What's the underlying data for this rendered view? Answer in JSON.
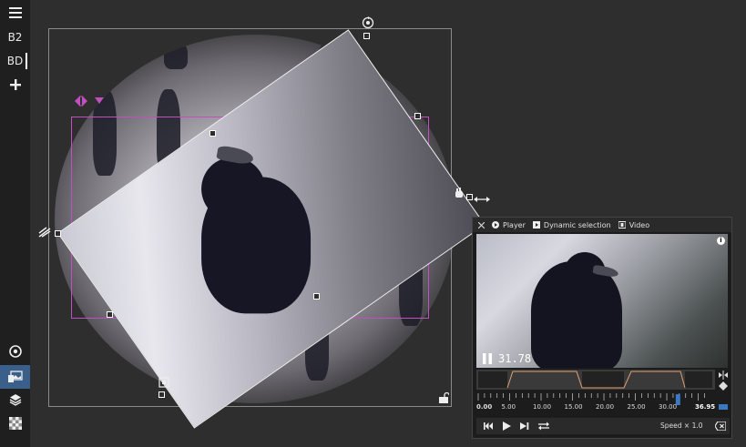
{
  "sidebar": {
    "items": [
      {
        "name": "menu-icon"
      },
      {
        "label": "B2"
      },
      {
        "label": "BD"
      },
      {
        "name": "add-icon"
      }
    ],
    "bottom_items": [
      {
        "name": "target-icon"
      },
      {
        "name": "image-select-icon"
      },
      {
        "name": "layers-icon"
      },
      {
        "name": "checkerboard-icon"
      }
    ]
  },
  "player": {
    "tabs": [
      {
        "label": "Player",
        "icon": "play-circle-icon"
      },
      {
        "label": "Dynamic selection",
        "icon": "play-square-icon"
      },
      {
        "label": "Video",
        "icon": "film-icon"
      }
    ],
    "timecode": "31.78",
    "ruler": {
      "ticks": [
        "0.00",
        "5.00",
        "10.00",
        "15.00",
        "20.00",
        "25.00",
        "30.00"
      ],
      "end_label": "36.95",
      "duration": 36.95,
      "playhead": 31.78
    },
    "speed_label": "Speed × 1.0"
  },
  "colors": {
    "accent": "#3a78c4",
    "selection": "#c04fc0",
    "segment_line": "#e0a070"
  }
}
